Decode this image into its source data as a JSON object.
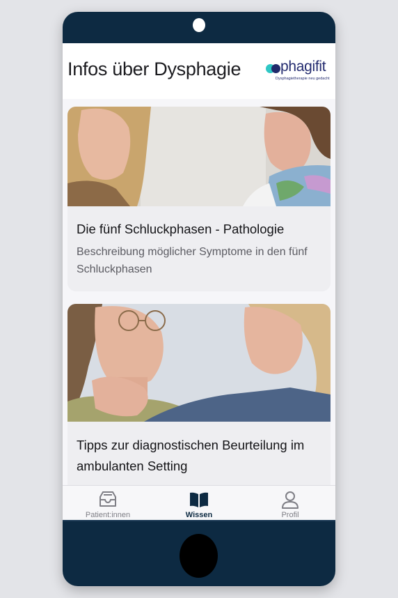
{
  "header": {
    "title": "Infos über Dysphagie",
    "logo_text": "phagifit",
    "logo_tagline": "Dysphagietherapie neu gedacht"
  },
  "cards": [
    {
      "title": "Die fünf Schluckphasen - Pathologie",
      "description": "Beschreibung möglicher Symptome in den fünf Schluckphasen",
      "image": "photo-two-therapists"
    },
    {
      "title": "Tipps zur diagnostischen Beurteilung im ambulanten Setting",
      "image": "photo-neck-examination"
    }
  ],
  "tabbar": {
    "items": [
      {
        "label": "Patient:innen",
        "icon": "inbox-tray-icon",
        "active": false
      },
      {
        "label": "Wissen",
        "icon": "open-book-icon",
        "active": true
      },
      {
        "label": "Profil",
        "icon": "person-icon",
        "active": false
      }
    ]
  },
  "colors": {
    "device_frame": "#0d2a42",
    "brand_navy": "#232b6f",
    "brand_teal": "#2fc7c5",
    "active_tab": "#0d2a42",
    "inactive_tab": "#7e7e85"
  }
}
